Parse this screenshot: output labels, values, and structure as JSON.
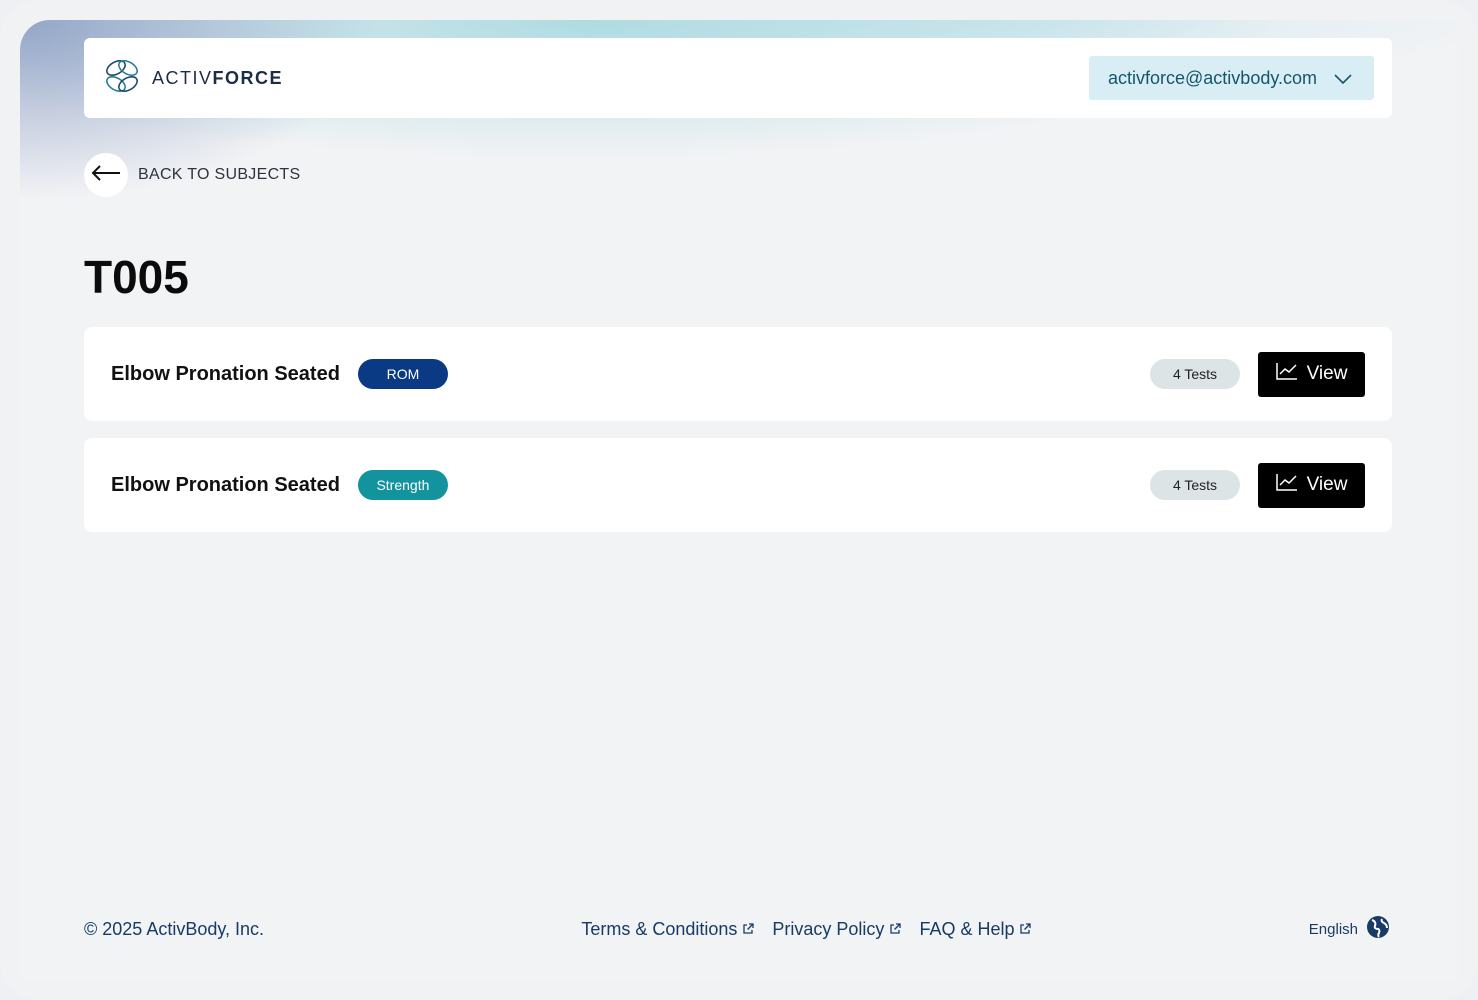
{
  "header": {
    "brand_light": "ACTIV",
    "brand_bold": "FORCE",
    "user_email": "activforce@activbody.com",
    "icons": {
      "logo": "activforce-logo-icon",
      "dropdown": "chevron-down-icon"
    }
  },
  "nav": {
    "back_label": "BACK TO SUBJECTS",
    "back_icon": "arrow-left-icon"
  },
  "page": {
    "title": "T005"
  },
  "exercises": [
    {
      "name": "Elbow Pronation Seated",
      "tag": "ROM",
      "tag_color": "#0b3a85",
      "tests": "4 Tests",
      "view_label": "View",
      "view_icon": "line-chart-icon"
    },
    {
      "name": "Elbow Pronation Seated",
      "tag": "Strength",
      "tag_color": "#13939e",
      "tests": "4 Tests",
      "view_label": "View",
      "view_icon": "line-chart-icon"
    }
  ],
  "footer": {
    "copyright": "© 2025 ActivBody, Inc.",
    "links": [
      "Terms & Conditions",
      "Privacy Policy",
      "FAQ & Help"
    ],
    "link_icon": "external-link-icon",
    "language": "English",
    "language_icon": "globe-icon"
  },
  "colors": {
    "brand_dark": "#1c2c45",
    "footer_text": "#173b66",
    "email_bg": "#d8eef4"
  }
}
